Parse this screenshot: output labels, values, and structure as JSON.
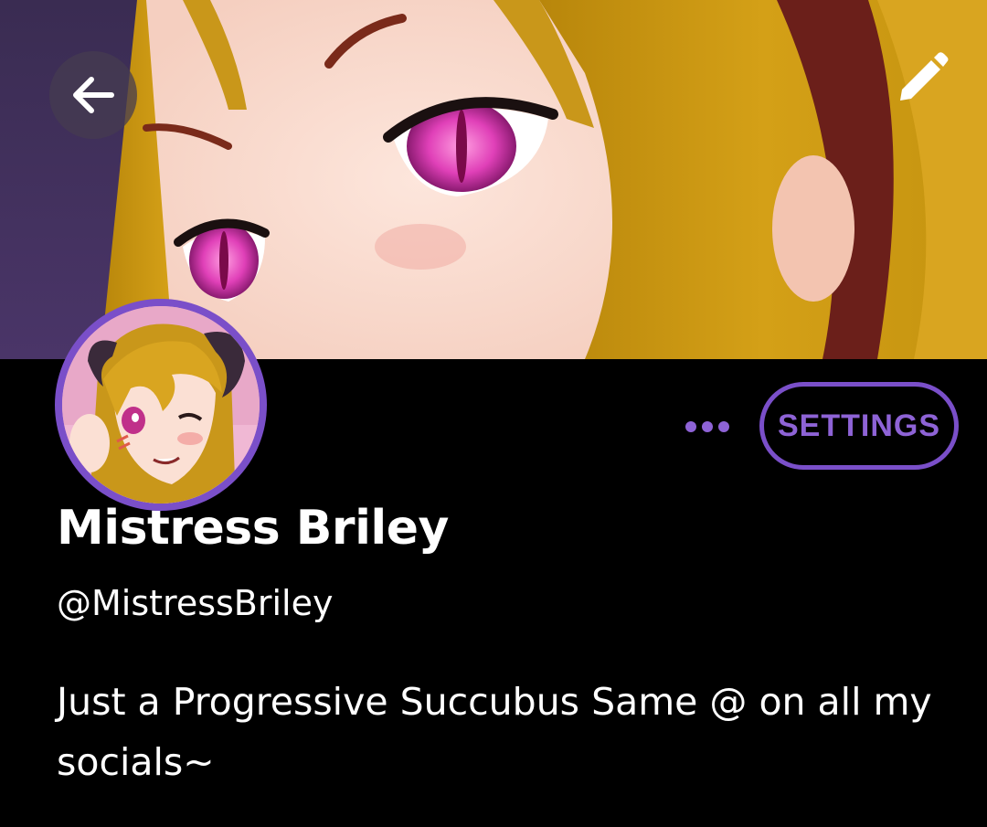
{
  "header": {
    "back_icon": "arrow-left-icon",
    "edit_icon": "pencil-icon"
  },
  "profile": {
    "display_name": "Mistress Briley",
    "handle": "@MistressBriley",
    "bio": "Just a Progressive Succubus Same @ on all my socials~"
  },
  "actions": {
    "more_icon": "more-horizontal-icon",
    "settings_label": "SETTINGS"
  },
  "colors": {
    "accent": "#7a4fc9",
    "background": "#000000",
    "text": "#ffffff"
  }
}
